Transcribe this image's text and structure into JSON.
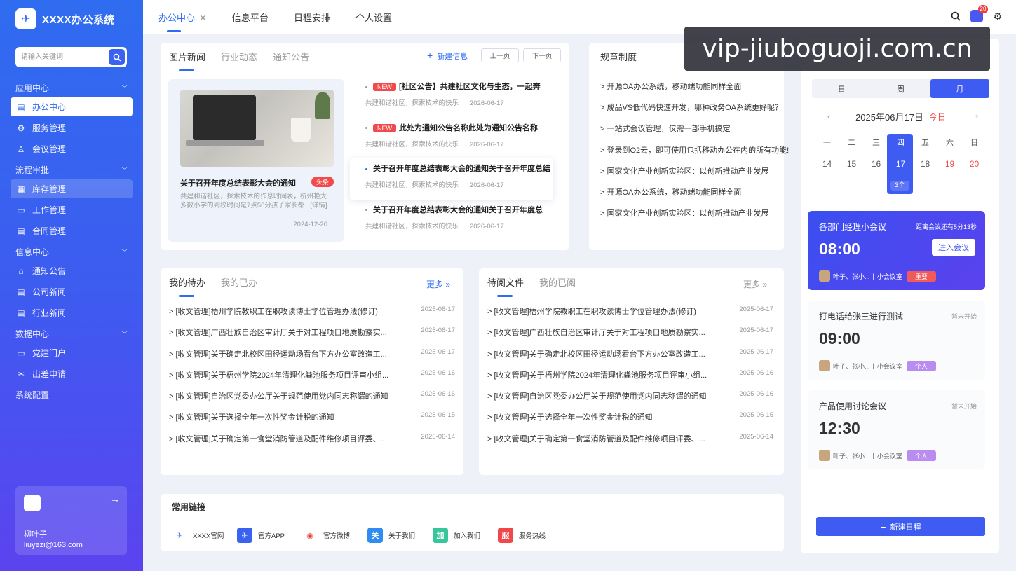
{
  "app": {
    "title": "XXXX办公系统"
  },
  "search": {
    "placeholder": "请输入关键词"
  },
  "nav": {
    "groups": [
      {
        "label": "应用中心",
        "items": [
          "办公中心",
          "服务管理",
          "会议管理"
        ]
      },
      {
        "label": "流程审批",
        "items": [
          "库存管理",
          "工作管理",
          "合同管理"
        ]
      },
      {
        "label": "信息中心",
        "items": [
          "通知公告",
          "公司新闻",
          "行业新闻"
        ]
      },
      {
        "label": "数据中心",
        "items": [
          "党建门户",
          "出差申请"
        ]
      }
    ],
    "system": "系统配置"
  },
  "user": {
    "name": "柳叶子",
    "email": "liuyezi@163.com"
  },
  "topbar": {
    "tabs": [
      "办公中心",
      "信息平台",
      "日程安排",
      "个人设置"
    ],
    "badge": "20"
  },
  "news": {
    "tabs": [
      "图片新闻",
      "行业动态",
      "通知公告"
    ],
    "new_label": "新建信息",
    "prev": "上一页",
    "next": "下一页",
    "feature": {
      "title": "关于召开年度总结表彰大会的通知",
      "tag": "头条",
      "desc": "共建和谐社区，探索技术的作息时间表，杭州艳大多数小学的到校时间是7点50分孩子家长都...[详情]",
      "date": "2024-12-20"
    },
    "items": [
      {
        "new": "NEW",
        "title": "[社区公告】共建社区文化与生态，一起奔",
        "source": "共建和谐社区，探索技术的快乐",
        "date": "2026-06-17"
      },
      {
        "new": "NEW",
        "title": "此处为通知公告名称此处为通知公告名称",
        "source": "共建和谐社区，探索技术的快乐",
        "date": "2026-06-17"
      },
      {
        "new": "",
        "title": "关于召开年度总结表彰大会的通知关于召开年度总结",
        "source": "共建和谐社区，探索技术的快乐",
        "date": "2026-06-17"
      },
      {
        "new": "",
        "title": "关于召开年度总结表彰大会的通知关于召开年度总",
        "source": "共建和谐社区，探索技术的快乐",
        "date": "2026-06-17"
      }
    ]
  },
  "rules": {
    "title": "规章制度",
    "items": [
      "> 开源OA办公系统，移动端功能同样全面",
      "> 成品VS低代码快速开发，哪种政务OA系统更好呢？",
      "> 一站式会议管理，仅需一部手机搞定",
      "> 登录到O2云，即可使用包括移动办公在内的所有功能!",
      "> 国家文化产业创新实验区：以创新推动产业发展",
      "> 开源OA办公系统，移动端功能同样全面",
      "> 国家文化产业创新实验区：以创新推动产业发展"
    ]
  },
  "todo": {
    "tabs": [
      "我的待办",
      "我的已办"
    ],
    "more": "更多",
    "items": [
      {
        "title": "> [收文管理]梧州学院教职工在职攻读博士学位管理办法(修订)",
        "date": "2025-06-17"
      },
      {
        "title": "> [收文管理]广西壮族自治区审计厅关于对工程项目地质勘察实...",
        "date": "2025-06-17"
      },
      {
        "title": "> [收文管理]关于确走北校区田径运动场看台下方办公室改造工...",
        "date": "2025-06-17"
      },
      {
        "title": "> [收文管理]关于梧州学院2024年清理化粪池服务项目评审小组...",
        "date": "2025-06-16"
      },
      {
        "title": "> [收文管理]自治区党委办公厅关于规范使用党内同志称谓的通知",
        "date": "2025-06-16"
      },
      {
        "title": "> [收文管理]关于选择全年一次性奖金计税的通知",
        "date": "2025-06-15"
      },
      {
        "title": "> [收文管理]关于确定第一食堂消防管道及配件维修项目评委、...",
        "date": "2025-06-14"
      }
    ]
  },
  "docs": {
    "tabs": [
      "待阅文件",
      "我的已阅"
    ],
    "more": "更多",
    "items": [
      {
        "title": "> [收文管理]梧州学院教职工在职攻读博士学位管理办法(修订)",
        "date": "2025-06-17"
      },
      {
        "title": "> [收文管理]广西壮族自治区审计厅关于对工程项目地质勘察实...",
        "date": "2025-06-17"
      },
      {
        "title": "> [收文管理]关于确走北校区田径运动场看台下方办公室改造工...",
        "date": "2025-06-17"
      },
      {
        "title": "> [收文管理]关于梧州学院2024年清理化粪池服务项目评审小组...",
        "date": "2025-06-16"
      },
      {
        "title": "> [收文管理]自治区党委办公厅关于规范使用党内同志称谓的通知",
        "date": "2025-06-16"
      },
      {
        "title": "> [收文管理]关于选择全年一次性奖金计税的通知",
        "date": "2025-06-15"
      },
      {
        "title": "> [收文管理]关于确定第一食堂消防管道及配件维修项目评委、...",
        "date": "2025-06-14"
      }
    ]
  },
  "links": {
    "title": "常用链接",
    "items": [
      {
        "label": "XXXX官网",
        "icon": "logo-icon",
        "glyph": "✈",
        "color": "#ffffff"
      },
      {
        "label": "官方APP",
        "icon": "app-icon",
        "glyph": "✈",
        "color": "#3a62f0"
      },
      {
        "label": "官方微博",
        "icon": "weibo-icon",
        "glyph": "◉",
        "color": "#ffffff"
      },
      {
        "label": "关于我们",
        "icon": "about-icon",
        "glyph": "关",
        "color": "#2f8cf0"
      },
      {
        "label": "加入我们",
        "icon": "join-icon",
        "glyph": "加",
        "color": "#37c59a"
      },
      {
        "label": "服务热线",
        "icon": "hotline-icon",
        "glyph": "服",
        "color": "#f2474a"
      }
    ]
  },
  "calendar": {
    "views": [
      "日",
      "周",
      "月"
    ],
    "title": "2025年06月17日",
    "today_label": "今日",
    "weekdays": [
      "一",
      "二",
      "三",
      "四",
      "五",
      "六",
      "日"
    ],
    "days": [
      "14",
      "15",
      "16",
      "17",
      "18",
      "19",
      "20"
    ],
    "count": "3个"
  },
  "meetings": [
    {
      "title": "各部门经理小会议",
      "status": "距离会议还有5分13秒",
      "time": "08:00",
      "people": "叶子、张小...",
      "room": "小会议室",
      "tag": "重要",
      "action": "进入会议"
    },
    {
      "title": "打电话给张三进行测试",
      "status": "暂未开始",
      "time": "09:00",
      "people": "叶子、张小...",
      "room": "小会议室",
      "tag": "个人"
    },
    {
      "title": "产品使用讨论会议",
      "status": "暂未开始",
      "time": "12:30",
      "people": "叶子、张小...",
      "room": "小会议室",
      "tag": "个人"
    }
  ],
  "schedule": {
    "new_label": "新建日程"
  },
  "watermark": "vip-jiuboguoji.com.cn",
  "colors": {
    "primary": "#3e5cf2",
    "danger": "#f24a4a",
    "personal": "#b98cf0"
  }
}
